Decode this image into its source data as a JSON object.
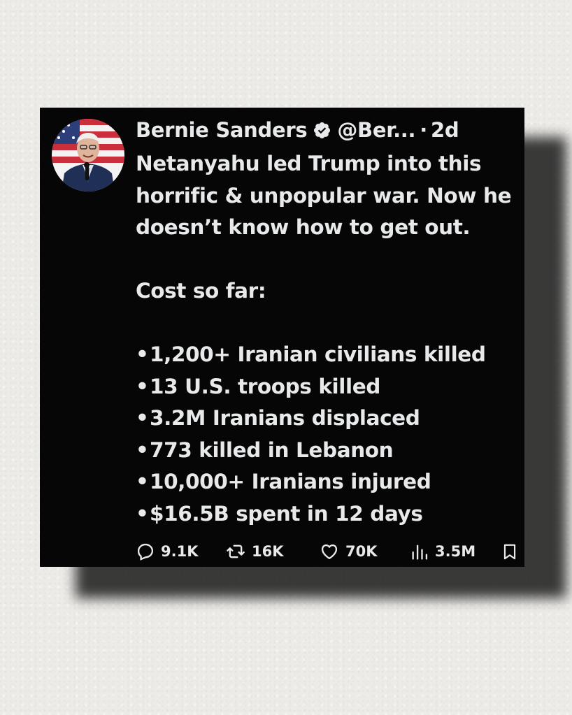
{
  "tweet": {
    "author_name": "Bernie Sanders",
    "handle": "@Ber...",
    "separator": "·",
    "time": "2d",
    "body_lines": [
      "Netanyahu led Trump into this",
      "horrific & unpopular war. Now he",
      "doesn’t know how to get out."
    ],
    "cost_heading": "Cost so far:",
    "bullets": [
      "1,200+ Iranian civilians killed",
      "13 U.S. troops killed",
      "3.2M Iranians displaced",
      "773 killed in Lebanon",
      "10,000+ Iranians injured",
      "$16.5B spent in 12 days"
    ],
    "bullet_glyph": "•",
    "stats": {
      "replies": "9.1K",
      "reposts": "16K",
      "likes": "70K",
      "views": "3.5M"
    }
  },
  "icons": {
    "verified": "verified-badge-icon",
    "reply": "reply-icon",
    "repost": "repost-icon",
    "like": "heart-icon",
    "views": "views-icon",
    "bookmark": "bookmark-icon"
  },
  "colors": {
    "background": "#ecebe7",
    "card": "#060606",
    "text": "#e7e9ea",
    "verified": "#1d9bf0"
  }
}
